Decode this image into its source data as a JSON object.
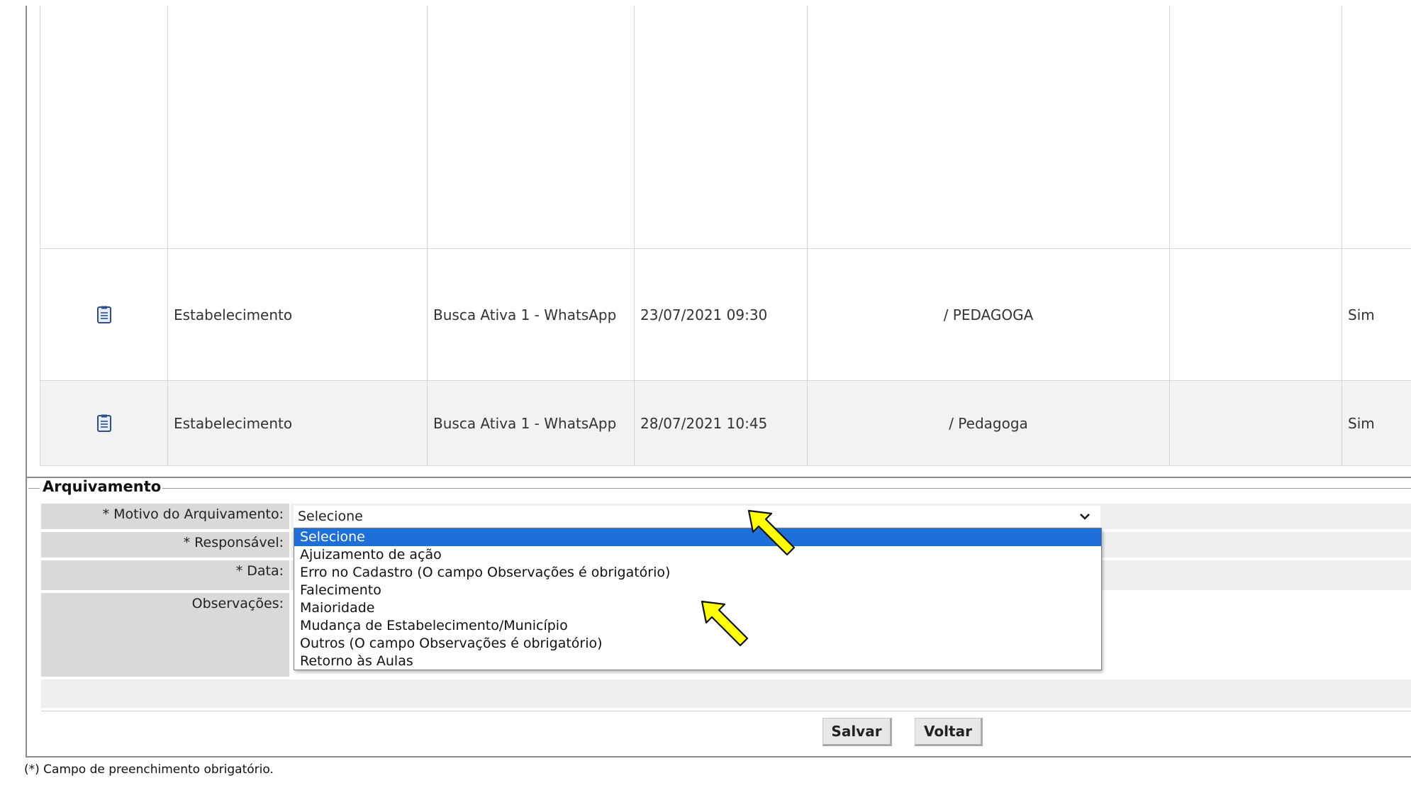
{
  "table": {
    "rows": [
      {
        "origem": "Estabelecimento",
        "tipo": "Busca Ativa 1 - WhatsApp",
        "data": "23/07/2021 09:30",
        "responsavel": "/ PEDAGOGA",
        "obs": "",
        "sim": "Sim"
      },
      {
        "origem": "Estabelecimento",
        "tipo": "Busca Ativa 1 - WhatsApp",
        "data": "28/07/2021 10:45",
        "responsavel": "/ Pedagoga",
        "obs": "",
        "sim": "Sim"
      }
    ]
  },
  "arquivamento": {
    "legend": "Arquivamento",
    "motivo_label": "* Motivo do Arquivamento:",
    "motivo_value": "Selecione",
    "responsavel_label": "* Responsável:",
    "data_label": "* Data:",
    "observacoes_label": "Observações:",
    "options": [
      "Selecione",
      "Ajuizamento de ação",
      "Erro no Cadastro (O campo Observações é obrigatório)",
      "Falecimento",
      "Maioridade",
      "Mudança de Estabelecimento/Município",
      "Outros (O campo Observações é obrigatório)",
      "Retorno às Aulas"
    ]
  },
  "buttons": {
    "salvar": "Salvar",
    "voltar": "Voltar"
  },
  "footnote": "(*) Campo de preenchimento obrigatório.",
  "colors": {
    "highlight": "#1e6fd9",
    "arrow": "#ffff00"
  },
  "icons": {
    "row_icon": "document-icon",
    "dropdown": "chevron-down-icon",
    "annotation": "arrow-icon"
  }
}
